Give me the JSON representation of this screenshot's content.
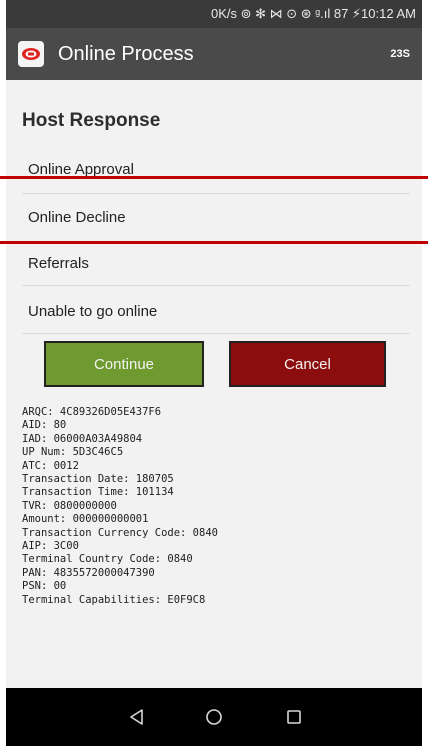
{
  "status_bar": {
    "text": "0K/s ⊚ ✻ ⋈ ⊙ ⊛ ᵍ.ıl 87 ⚡10:12 AM"
  },
  "app_bar": {
    "title": "Online Process",
    "right_label": "23S"
  },
  "host_response": {
    "title": "Host Response",
    "options": [
      "Online Approval",
      "Online Decline",
      "Referrals",
      "Unable to go online"
    ]
  },
  "buttons": {
    "continue_label": "Continue",
    "cancel_label": "Cancel"
  },
  "transaction_details": [
    "ARQC: 4C89326D05E437F6",
    "AID: 80",
    "IAD: 06000A03A49804",
    "UP Num: 5D3C46C5",
    "ATC: 0012",
    "Transaction Date: 180705",
    "Transaction Time: 101134",
    "TVR: 0800000000",
    "Amount: 000000000001",
    "Transaction Currency Code: 0840",
    "AIP: 3C00",
    "Terminal Country Code: 0840",
    "PAN: 4835572000047390",
    "PSN: 00",
    "Terminal Capabilities: E0F9C8"
  ],
  "nav_bar": {
    "icons": [
      "back-icon",
      "home-icon",
      "recents-icon"
    ]
  },
  "colors": {
    "continue": "#6f9a2f",
    "cancel": "#8b0d0d",
    "highlight": "#c00000"
  }
}
